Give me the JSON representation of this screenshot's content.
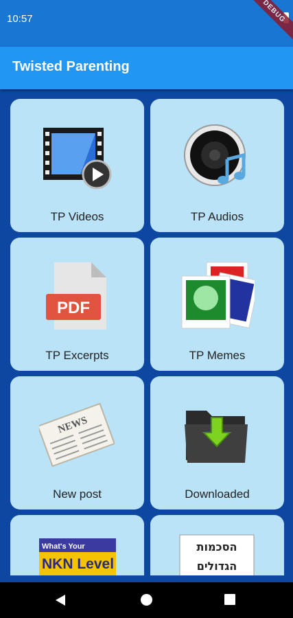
{
  "status_bar": {
    "time": "10:57"
  },
  "debug_banner": "DEBUG",
  "app_bar": {
    "title": "Twisted Parenting"
  },
  "tiles": [
    {
      "label": "TP Videos",
      "icon": "video-film-icon"
    },
    {
      "label": "TP Audios",
      "icon": "speaker-music-icon"
    },
    {
      "label": "TP Excerpts",
      "icon": "pdf-document-icon"
    },
    {
      "label": "TP Memes",
      "icon": "photos-icon"
    },
    {
      "label": "New post",
      "icon": "newspaper-icon"
    },
    {
      "label": "Downloaded",
      "icon": "download-folder-icon"
    },
    {
      "label": "",
      "icon": "nkn-level-thumbnail",
      "image_text": "What's Your NKN Level"
    },
    {
      "label": "",
      "icon": "hebrew-sign-thumbnail",
      "image_text": "הסכמות הגדולים"
    }
  ],
  "colors": {
    "status_bar": "#1976d2",
    "app_bar": "#2196f3",
    "background": "#0d47a1",
    "tile": "#bbe3f8"
  }
}
